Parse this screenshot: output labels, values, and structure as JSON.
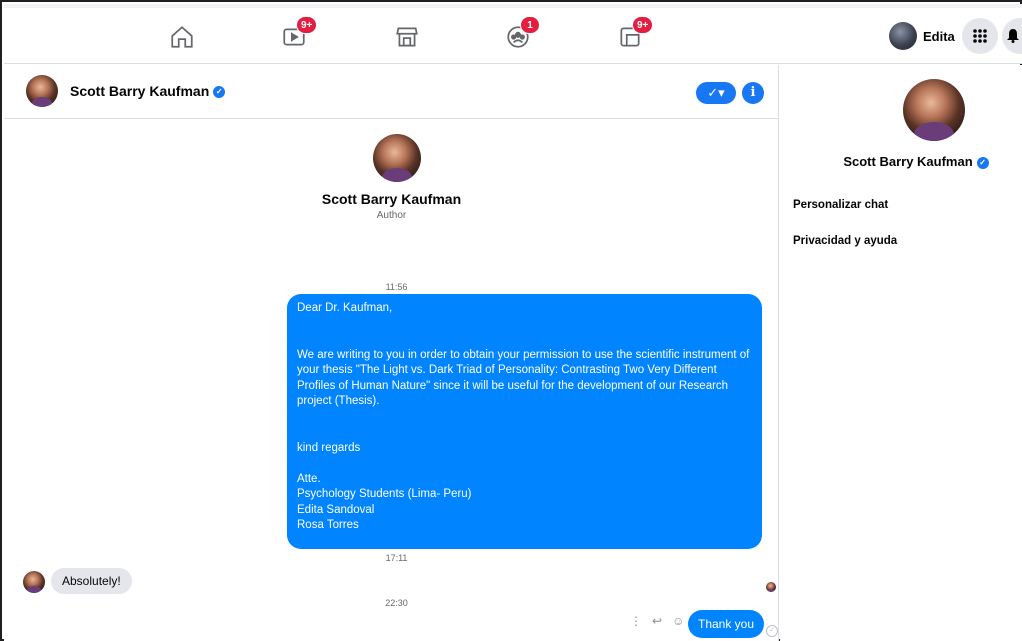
{
  "nav": {
    "icons": [
      {
        "name": "home-icon"
      },
      {
        "name": "watch-icon",
        "badge": "9+"
      },
      {
        "name": "marketplace-icon"
      },
      {
        "name": "groups-icon",
        "badge": "1"
      },
      {
        "name": "gaming-icon",
        "badge": "9+"
      }
    ],
    "profile_name": "Edita",
    "menu_icon": "grid-menu-icon",
    "notifications_icon": "bell-icon"
  },
  "chat": {
    "contact_name": "Scott Barry Kaufman",
    "contact_role": "Author",
    "header_check": "✓▾",
    "header_info": "i",
    "messages": [
      {
        "time": "11:56"
      },
      {
        "direction": "out",
        "text": "Dear Dr. Kaufman,\n\n\nWe are writing to you in order to obtain your permission to use the scientific instrument of your thesis \"The Light vs. Dark Triad of Personality: Contrasting Two Very Different Profiles of Human Nature\" since it will be useful for the development of our Research project (Thesis).\n\n\nkind regards\n\nAtte.\nPsychology Students (Lima- Peru)\nEdita Sandoval\nRosa Torres"
      },
      {
        "time": "17:11"
      },
      {
        "direction": "in",
        "text": "Absolutely!"
      },
      {
        "time": "22:30"
      },
      {
        "direction": "out",
        "text": "Thank you"
      }
    ]
  },
  "info_panel": {
    "name": "Scott Barry Kaufman",
    "items": [
      "Personalizar chat",
      "Privacidad y ayuda"
    ]
  },
  "colors": {
    "accent": "#1877f2",
    "bubble_out": "#0084ff",
    "bubble_in": "#e4e6eb",
    "badge": "#e41e3f"
  }
}
